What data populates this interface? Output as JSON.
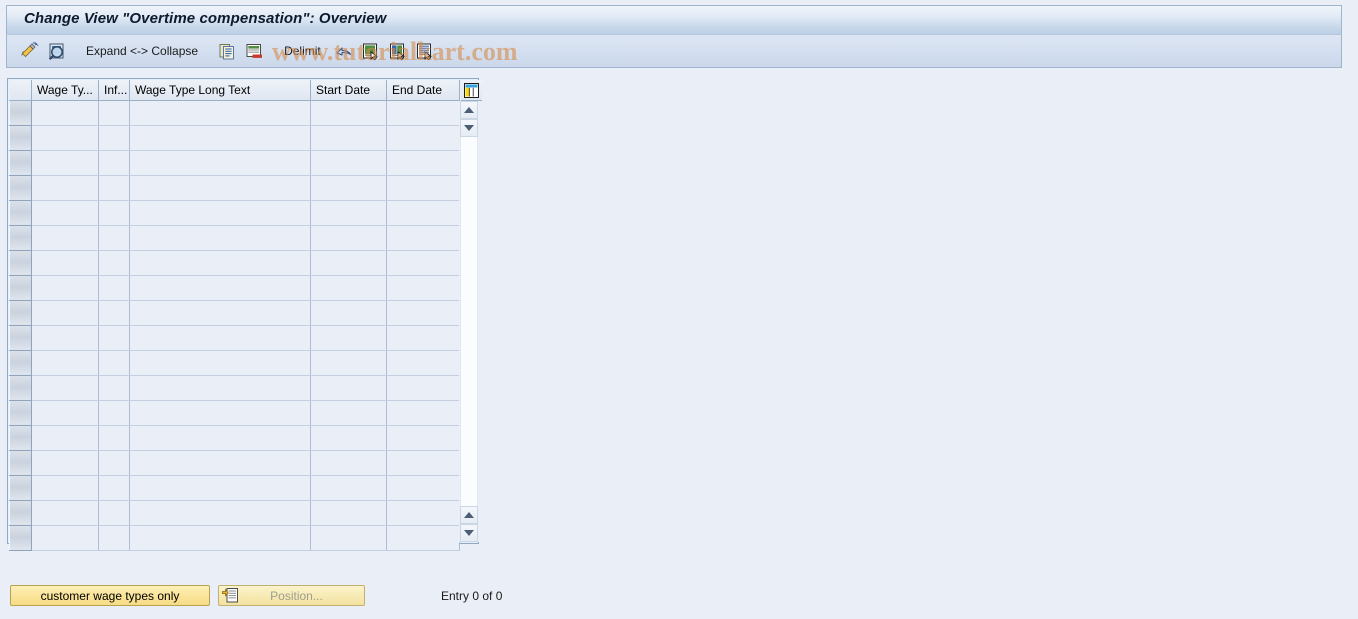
{
  "window": {
    "title": "Change View \"Overtime compensation\": Overview"
  },
  "watermark": {
    "text": "www.tutorialkart.com",
    "color": "#d68c4a"
  },
  "toolbar": {
    "items": [
      {
        "name": "display-change-icon",
        "label": "",
        "icon": "pencil-icon",
        "type": "icon"
      },
      {
        "name": "display-icon",
        "label": "",
        "icon": "magnifier-document-icon",
        "type": "icon"
      },
      {
        "name": "expand-collapse",
        "label": "Expand <-> Collapse",
        "icon": "",
        "type": "text"
      },
      {
        "name": "copy-as-icon",
        "label": "",
        "icon": "copy-icon",
        "type": "icon"
      },
      {
        "name": "delete-icon",
        "label": "",
        "icon": "delete-row-icon",
        "type": "icon"
      },
      {
        "name": "delimit",
        "label": "Delimit",
        "icon": "",
        "type": "text"
      },
      {
        "name": "undo-icon",
        "label": "",
        "icon": "undo-arrow-icon",
        "type": "icon"
      },
      {
        "name": "select-all-icon",
        "label": "",
        "icon": "select-all-icon",
        "type": "icon"
      },
      {
        "name": "select-block-icon",
        "label": "",
        "icon": "select-block-icon",
        "type": "icon"
      },
      {
        "name": "deselect-all-icon",
        "label": "",
        "icon": "deselect-all-icon",
        "type": "icon"
      }
    ],
    "expand_collapse_label": "Expand <-> Collapse",
    "delimit_label": "Delimit"
  },
  "table": {
    "columns": [
      {
        "key": "select",
        "label": ""
      },
      {
        "key": "wage_type",
        "label": "Wage Ty..."
      },
      {
        "key": "infotype",
        "label": "Inf..."
      },
      {
        "key": "long_text",
        "label": "Wage Type Long Text"
      },
      {
        "key": "start_date",
        "label": "Start Date"
      },
      {
        "key": "end_date",
        "label": "End Date"
      }
    ],
    "rows": [],
    "empty_row_count": 18,
    "settings_icon": "table-settings-icon"
  },
  "footer": {
    "customer_wage_types_label": "customer wage types only",
    "position_label": "Position...",
    "position_enabled": false,
    "entry_count_label": "Entry 0 of 0"
  }
}
